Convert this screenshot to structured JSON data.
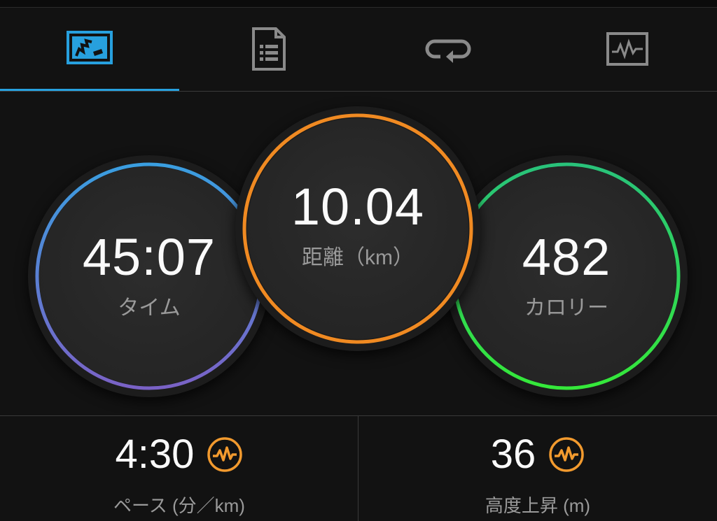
{
  "tabs": [
    {
      "icon": "summary-map-icon",
      "active": true
    },
    {
      "icon": "details-list-icon",
      "active": false
    },
    {
      "icon": "laps-repeat-icon",
      "active": false
    },
    {
      "icon": "chart-graph-icon",
      "active": false
    }
  ],
  "colors": {
    "accent": "#27a0de",
    "time_ring_top": "#3a9ee0",
    "time_ring_bottom": "#7a62c6",
    "distance_ring": "#f08a22",
    "calorie_ring_top": "#29c27a",
    "calorie_ring_bottom": "#35e83a",
    "badge": "#f29a2e"
  },
  "rings": {
    "time": {
      "value": "45:07",
      "label": "タイム"
    },
    "distance": {
      "value": "10.04",
      "label": "距離（km）"
    },
    "calories": {
      "value": "482",
      "label": "カロリー"
    }
  },
  "metrics": {
    "pace": {
      "value": "4:30",
      "label": "ペース (分／km)",
      "badge_icon": "heart-rate-icon"
    },
    "elevation": {
      "value": "36",
      "label": "高度上昇 (m)",
      "badge_icon": "heart-rate-icon"
    }
  }
}
